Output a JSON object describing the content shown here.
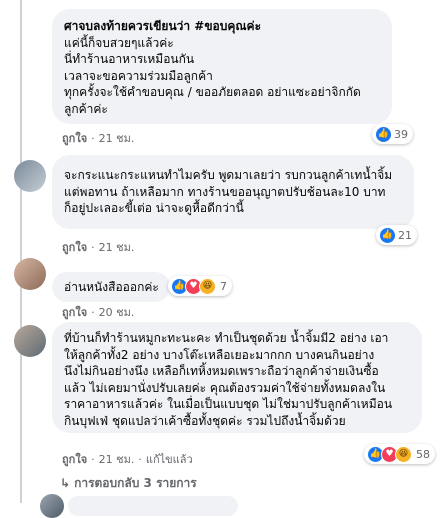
{
  "comments": [
    {
      "lines": [
        "ศาจบลงท้ายควรเขียนว่า #ขอบคุณค่ะ",
        "แค่นี้ก็จบสวยๆแล้วค่ะ",
        "นี่ทำร้านอาหารเหมือนกัน",
        "เวลาจะขอความร่วมมือลูกค้า",
        "ทุกครั้งจะใช้คำขอบคุณ / ขออภัยตลอด อย่าแซะอย่าจิกกัด",
        "ลูกค้าค่ะ"
      ],
      "like_label": "ถูกใจ",
      "time": "21 ชม.",
      "reaction_count": "39"
    },
    {
      "lines": [
        "จะกระแนะกระแหนทำไมครับ พูดมาเลยว่า รบกวนลูกค้าเทน้ำจิ้ม",
        "แต่พอทาน ถ้าเหลือมาก ทางร้านขออนุญาตปรับช้อนละ10 บาท",
        "ก็อยู่ปะเลอะขี้เต่อ น่าจะดูหื้อดีกว่านี้"
      ],
      "like_label": "ถูกใจ",
      "time": "21 ชม.",
      "reaction_count": "21"
    },
    {
      "lines": [
        "อ่านหนังสือออกค่ะ"
      ],
      "like_label": "ถูกใจ",
      "time": "20 ชม.",
      "reaction_count": "7"
    },
    {
      "lines": [
        "ที่บ้านก็ทำร้านหมูกะทะนะคะ ทำเป็นชุดด้วย น้ำจิ้มมี2 อย่าง เอา",
        "ให้ลูกค้าทั้ง2 อย่าง บางโต๊ะเหลือเยอะมากกก บางคนกินอย่าง",
        "นึงไม่กินอย่างนึง เหลือก็เทหิ้งหมดเพราะถือว่าลูกค้าจ่ายเงินซื้อ",
        "แล้ว ไม่เคยมานั่งปรับเลยค่ะ คุณต้องรวมค่าใช้จ่ายทั้งหมดลงใน",
        "ราคาอาหารแล้วค่ะ ในเมื่อเป็นแบบชุด ไม่ใช่มาปรับลูกค้าเหมือน",
        "กินบุฟเฟ่ ชุดแปลว่าเค้าซื้อทั้งชุดค่ะ รวมไปถึงน้ำจิ้มด้วย"
      ],
      "like_label": "ถูกใจ",
      "time": "21 ชม.",
      "edited_label": "แก้ไขแล้ว",
      "reaction_count": "58"
    }
  ],
  "replies_link": "การตอบกลับ 3 รายการ",
  "colors": {
    "bubble": "#f0f2f5",
    "like_blue": "#1877f2",
    "love_red": "#f33e58",
    "haha_yellow": "#f7b125",
    "meta_gray": "#65676b"
  }
}
